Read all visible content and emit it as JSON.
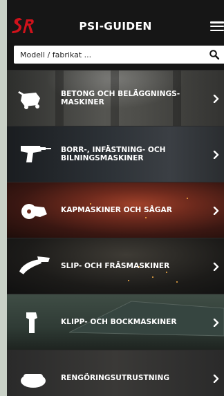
{
  "header": {
    "logo_text": "SR",
    "title": "PSI-GUIDEN",
    "menu_icon": "hamburger-menu-icon"
  },
  "search": {
    "placeholder": "Modell / fabrikat ...",
    "value": "",
    "icon": "search-icon"
  },
  "categories": [
    {
      "label": "Betong och beläggnings-maskiner",
      "icon": "concrete-mixer-icon"
    },
    {
      "label": "Borr-, infästning- och bilningsmaskiner",
      "icon": "drill-icon"
    },
    {
      "label": "Kapmaskiner och sågar",
      "icon": "cut-off-saw-icon"
    },
    {
      "label": "Slip- och fräsmaskiner",
      "icon": "angle-grinder-icon"
    },
    {
      "label": "Klipp- och bockmaskiner",
      "icon": "cutter-icon"
    },
    {
      "label": "Rengöringsutrustning",
      "icon": "cleaning-machine-icon"
    }
  ],
  "colors": {
    "header_bg": "#161616",
    "text": "#ffffff",
    "logo_red": "#d0121b",
    "page_bg": "#c9d1c7"
  }
}
